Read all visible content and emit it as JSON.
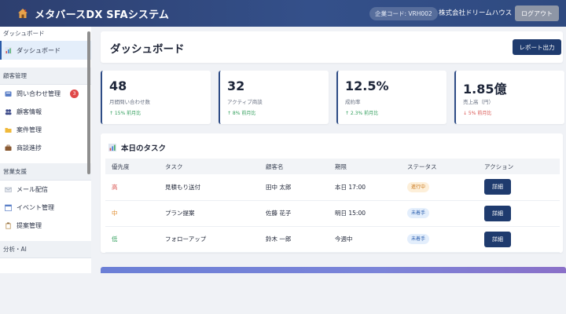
{
  "header": {
    "title": "メタバースDX SFAシステム",
    "company_code": "企業コード: VRH002",
    "company_name": "株式会社ドリームハウス",
    "logout_label": "ログアウト"
  },
  "sidebar": {
    "sections": [
      {
        "label": "ダッシュボード",
        "items": [
          {
            "label": "ダッシュボード",
            "icon": "chart-icon",
            "active": true
          }
        ]
      },
      {
        "label": "顧客管理",
        "items": [
          {
            "label": "問い合わせ管理",
            "icon": "inbox-icon",
            "badge": "3"
          },
          {
            "label": "顧客情報",
            "icon": "users-icon"
          },
          {
            "label": "案件管理",
            "icon": "folder-icon"
          },
          {
            "label": "商談進捗",
            "icon": "briefcase-icon"
          }
        ]
      },
      {
        "label": "営業支援",
        "items": [
          {
            "label": "メール配信",
            "icon": "mail-icon"
          },
          {
            "label": "イベント管理",
            "icon": "calendar-icon"
          },
          {
            "label": "提案管理",
            "icon": "clipboard-icon"
          }
        ]
      },
      {
        "label": "分析・AI",
        "items": []
      }
    ]
  },
  "main": {
    "page_title": "ダッシュボード",
    "report_label": "レポート出力",
    "stats": [
      {
        "value": "48",
        "label": "月間問い合わせ数",
        "change": "↑ 15% 前月比",
        "trend": "up"
      },
      {
        "value": "32",
        "label": "アクティブ商談",
        "change": "↑ 8% 前月比",
        "trend": "up"
      },
      {
        "value": "12.5%",
        "label": "成約率",
        "change": "↑ 2.3% 前月比",
        "trend": "up"
      },
      {
        "value": "1.85億",
        "label": "売上高（円）",
        "change": "↓ 5% 前月比",
        "trend": "down"
      }
    ],
    "tasks": {
      "title": "本日のタスク",
      "columns": [
        "優先度",
        "タスク",
        "顧客名",
        "期限",
        "ステータス",
        "アクション"
      ],
      "rows": [
        {
          "priority": "高",
          "task": "見積もり送付",
          "customer": "田中 太郎",
          "deadline": "本日 17:00",
          "status": "進行中",
          "action": "詳細"
        },
        {
          "priority": "中",
          "task": "プラン提案",
          "customer": "佐藤 花子",
          "deadline": "明日 15:00",
          "status": "未着手",
          "action": "詳細"
        },
        {
          "priority": "低",
          "task": "フォローアップ",
          "customer": "鈴木 一郎",
          "deadline": "今週中",
          "status": "未着手",
          "action": "詳細"
        }
      ]
    }
  }
}
